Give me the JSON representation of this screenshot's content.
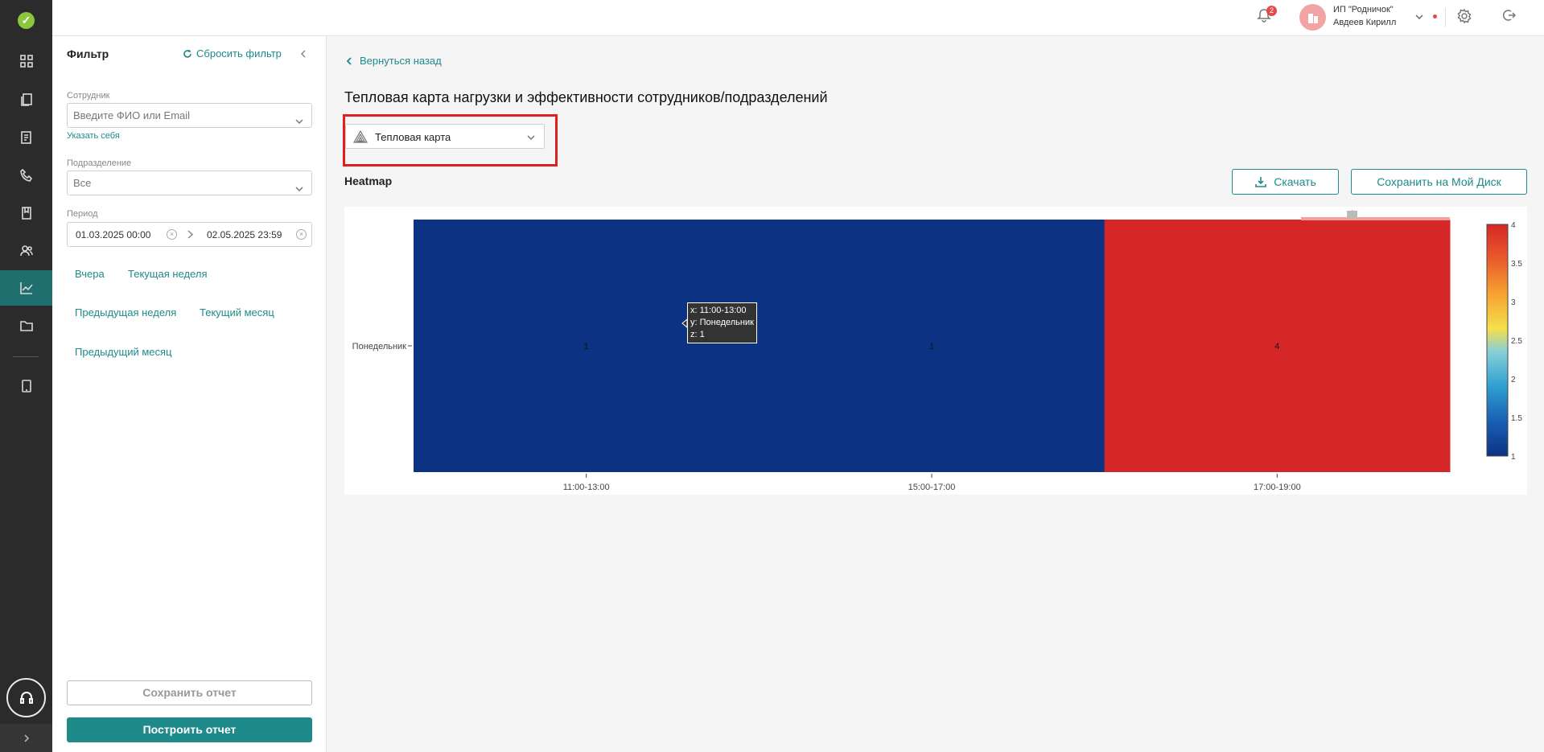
{
  "app": {
    "notifications_count": "2",
    "org_name": "ИП \"Родничок\"",
    "user_name": "Авдеев Кирилл"
  },
  "rail_icons": [
    "dashboard-icon",
    "documents-icon",
    "reports-icon",
    "calls-icon",
    "book-icon",
    "users-icon",
    "analytics-icon",
    "folder-icon",
    "tablet-icon"
  ],
  "filter": {
    "title": "Фильтр",
    "reset_label": "Сбросить фильтр",
    "employee_label": "Сотрудник",
    "employee_placeholder": "Введите ФИО или Email",
    "set_self_label": "Указать себя",
    "department_label": "Подразделение",
    "department_value": "Все",
    "period_label": "Период",
    "date_from": "01.03.2025 00:00",
    "date_to": "02.05.2025 23:59",
    "quick": [
      "Вчера",
      "Текущая неделя",
      "Предыдущая неделя",
      "Текущий месяц",
      "Предыдущий месяц"
    ],
    "save_label": "Сохранить отчет",
    "build_label": "Построить отчет"
  },
  "main": {
    "back_label": "Вернуться назад",
    "title": "Тепловая карта нагрузки и эффективности сотрудников/подразделений",
    "view_select": "Тепловая карта",
    "chart_label": "Heatmap",
    "download_label": "Скачать",
    "save_disk_label": "Сохранить на Мой Диск"
  },
  "colors": {
    "accent": "#1f8a8a",
    "highlight": "#e02020",
    "low": "#0c3283",
    "high": "#d62728"
  },
  "chart_data": {
    "type": "heatmap",
    "title": "",
    "x": [
      "11:00-13:00",
      "15:00-17:00",
      "17:00-19:00"
    ],
    "y": [
      "Понедельник"
    ],
    "z": [
      [
        1,
        1,
        4
      ]
    ],
    "colorscale": "RdYlBu reversed",
    "zlim": [
      1,
      4
    ],
    "colorbar_ticks": [
      "1",
      "1.5",
      "2",
      "2.5",
      "3",
      "3.5",
      "4"
    ],
    "tooltip": {
      "x": "x: 11:00-13:00",
      "y": "y: Понедельник",
      "z": "z: 1"
    }
  }
}
